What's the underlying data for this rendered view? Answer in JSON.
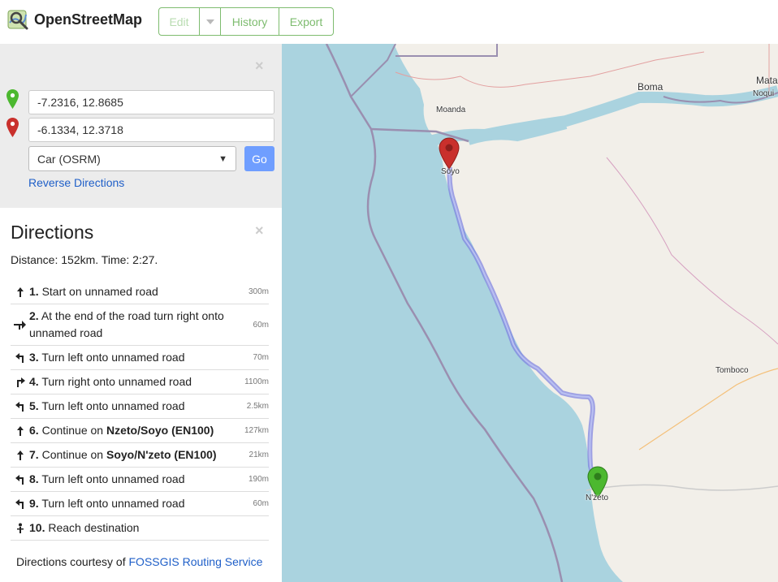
{
  "header": {
    "brand": "OpenStreetMap",
    "edit_label": "Edit",
    "history_label": "History",
    "export_label": "Export"
  },
  "directions_form": {
    "from_value": "-7.2316, 12.8685",
    "to_value": "-6.1334, 12.3718",
    "engine": "Car (OSRM)",
    "go_label": "Go",
    "reverse_label": "Reverse Directions",
    "close_glyph": "×"
  },
  "directions": {
    "title": "Directions",
    "summary": "Distance: 152km. Time: 2:27.",
    "close_glyph": "×",
    "steps": [
      {
        "num": "1.",
        "text": "Start on unnamed road",
        "dist": "300m",
        "icon": "straight-arrow-icon"
      },
      {
        "num": "2.",
        "text": "At the end of the road turn right onto unnamed road",
        "dist": "60m",
        "icon": "end-right-turn-icon"
      },
      {
        "num": "3.",
        "text": "Turn left onto unnamed road",
        "dist": "70m",
        "icon": "left-turn-icon"
      },
      {
        "num": "4.",
        "text": "Turn right onto unnamed road",
        "dist": "1100m",
        "icon": "right-turn-icon"
      },
      {
        "num": "5.",
        "text": "Turn left onto unnamed road",
        "dist": "2.5km",
        "icon": "left-turn-icon"
      },
      {
        "num": "6.",
        "text_prefix": "Continue on ",
        "text_bold": "Nzeto/Soyo (EN100)",
        "dist": "127km",
        "icon": "straight-arrow-icon"
      },
      {
        "num": "7.",
        "text_prefix": "Continue on ",
        "text_bold": "Soyo/N'zeto (EN100)",
        "dist": "21km",
        "icon": "straight-arrow-icon"
      },
      {
        "num": "8.",
        "text": "Turn left onto unnamed road",
        "dist": "190m",
        "icon": "left-turn-icon"
      },
      {
        "num": "9.",
        "text": "Turn left onto unnamed road",
        "dist": "60m",
        "icon": "left-turn-icon"
      },
      {
        "num": "10.",
        "text": "Reach destination",
        "dist": "",
        "icon": "destination-pin-icon"
      }
    ],
    "attribution_prefix": "Directions courtesy of ",
    "attribution_link": "FOSSGIS Routing Service"
  },
  "map": {
    "labels": {
      "boma": "Boma",
      "mata": "Mata",
      "noqui": "Noqui",
      "moanda": "Moanda",
      "soyo": "Soyo",
      "tomboco": "Tomboco",
      "nzeto": "N'zeto"
    },
    "colors": {
      "sea": "#aad3df",
      "land": "#f2efe9",
      "route": "#7b7fe0",
      "start_marker": "#4cb82f",
      "end_marker": "#c9302c"
    }
  }
}
